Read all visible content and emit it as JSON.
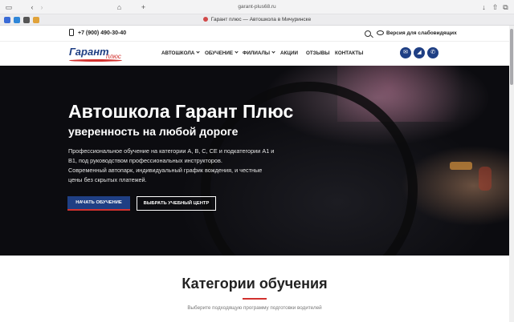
{
  "browser": {
    "url": "garant-plus68.ru",
    "tab_title": "Гарант плюс — Автошкола в Мичуринске",
    "back_icon": "‹",
    "forward_icon": "›",
    "new_tab_icon": "+",
    "home_icon": "⌂",
    "share_icon": "⇧",
    "download_icon": "↓",
    "tabs_icon": "⧉"
  },
  "topbar": {
    "phone": "+7 (900) 490-30-40",
    "accessibility": "Версия для слабовидящих"
  },
  "logo": {
    "main": "Гарант",
    "sub": "плюс"
  },
  "nav": {
    "items": [
      "АВТОШКОЛА",
      "ОБУЧЕНИЕ",
      "ФИЛИАЛЫ",
      "АКЦИИ",
      "ОТЗЫВЫ",
      "КОНТАКТЫ"
    ],
    "social": [
      "✉",
      "◢",
      "✆"
    ]
  },
  "hero": {
    "title": "Автошкола Гарант Плюс",
    "subtitle": "уверенность на любой дороге",
    "description_lines": [
      "Профессиональное обучение на категории А, В, С, СЕ и подкатегории А1 и",
      "В1, под руководством профессиональных инструкторов.",
      "Современный автопарк, индивидуальный график вождения, и честные",
      "цены без скрытых платежей."
    ],
    "btn_primary": "НАЧАТЬ ОБУЧЕНИЕ",
    "btn_secondary": "ВЫБРАТЬ УЧЕБНЫЙ ЦЕНТР"
  },
  "categories": {
    "title": "Категории обучения",
    "subtitle": "Выберите подходящую программу подготовки водителей"
  },
  "colors": {
    "brand": "#1f3f84",
    "accent": "#d2312e"
  }
}
